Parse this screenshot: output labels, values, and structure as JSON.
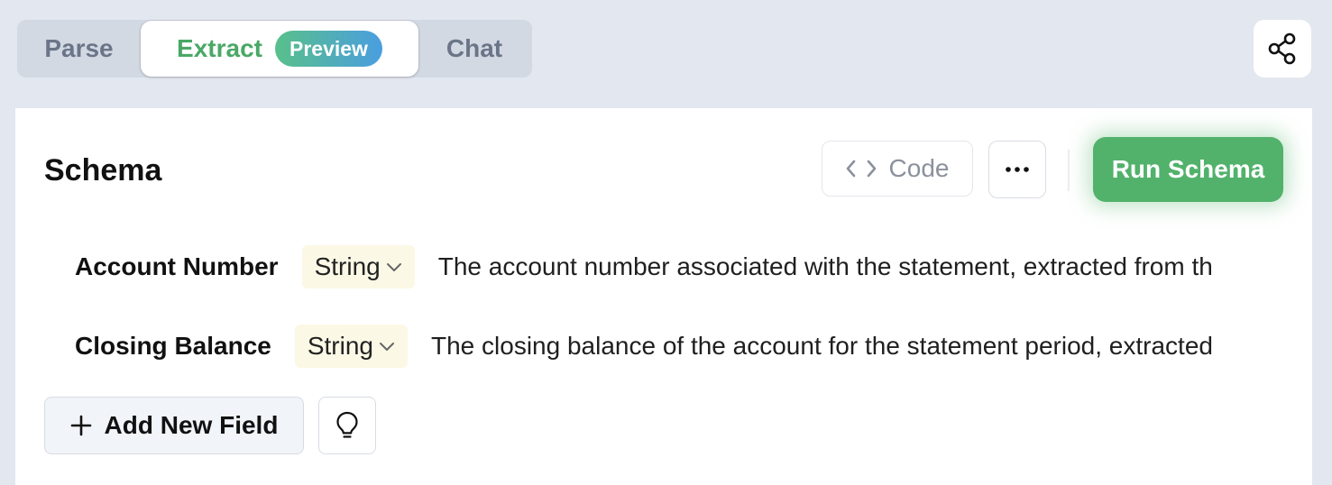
{
  "tabs": {
    "parse": "Parse",
    "extract": "Extract",
    "extract_badge": "Preview",
    "chat": "Chat",
    "active": "Extract"
  },
  "header": {
    "share_icon": "share-icon"
  },
  "schema": {
    "title": "Schema",
    "code_label": "Code",
    "code_icon": "code-brackets-icon",
    "more_icon": "ellipsis-icon",
    "run_label": "Run Schema",
    "fields": [
      {
        "name": "Account Number",
        "type": "String",
        "description": "The account number associated with the statement, extracted from th"
      },
      {
        "name": "Closing Balance",
        "type": "String",
        "description": "The closing balance of the account for the statement period, extracted"
      }
    ],
    "add_field_label": "Add New Field",
    "add_icon": "plus-icon",
    "hint_icon": "lightbulb-icon"
  },
  "colors": {
    "accent_green": "#52b26b",
    "tab_active_text": "#4aa866",
    "badge_gradient_start": "#58c08a",
    "badge_gradient_end": "#4a9ee0",
    "type_chip_bg": "#fbf8e6",
    "page_bg": "#e3e7ef"
  }
}
